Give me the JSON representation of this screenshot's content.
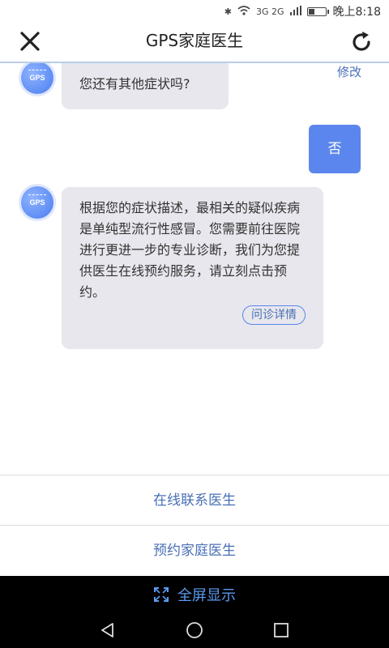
{
  "status_bar": {
    "network": "3G 2G",
    "time": "晚上8:18"
  },
  "header": {
    "title": "GPS家庭医生"
  },
  "avatar_text": "GPS",
  "messages": {
    "edit_link": "修改",
    "q1": "您还有其他症状吗?",
    "answer": "否",
    "diagnosis": "根据您的症状描述，最相关的疑似疾病是单纯型流行性感冒。您需要前往医院进行更进一步的专业诊断，我们为您提供医生在线预约服务，请立刻点击预约。",
    "detail_button": "问诊详情"
  },
  "actions": {
    "contact_doctor": "在线联系医生",
    "book_doctor": "预约家庭医生"
  },
  "fullscreen": {
    "label": "全屏显示"
  },
  "colors": {
    "accent": "#5b86ed",
    "link": "#4a6fb5",
    "bubble": "#e7e7ed"
  }
}
